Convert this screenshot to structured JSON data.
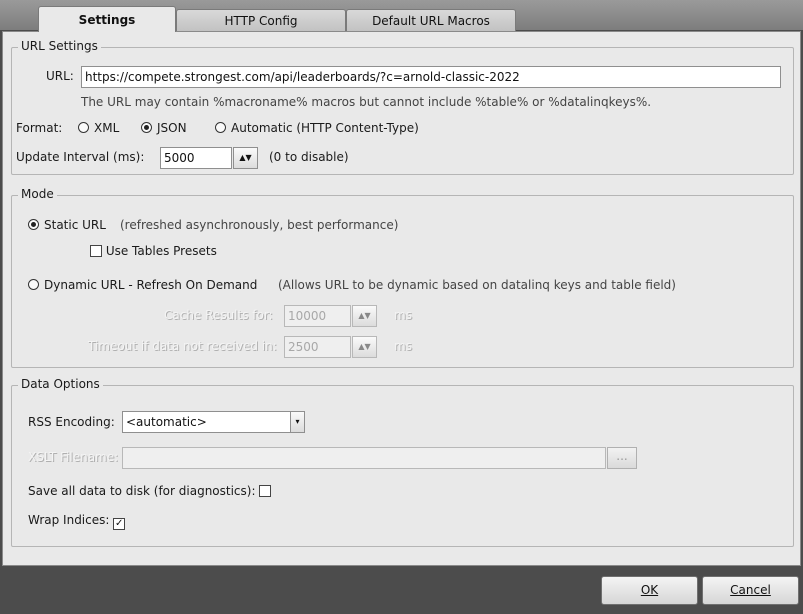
{
  "tabs": [
    {
      "label": "Settings",
      "active": true
    },
    {
      "label": "HTTP Config",
      "active": false
    },
    {
      "label": "Default URL Macros",
      "active": false
    }
  ],
  "url_settings": {
    "legend": "URL Settings",
    "url_label": "URL:",
    "url_value": "https://compete.strongest.com/api/leaderboards/?c=arnold-classic-2022",
    "url_hint": "The URL may contain %macroname% macros but cannot include %table% or %datalinqkeys%.",
    "format_label": "Format:",
    "format_options": [
      "XML",
      "JSON",
      "Automatic (HTTP Content-Type)"
    ],
    "format_selected": "JSON",
    "interval_label": "Update Interval (ms):",
    "interval_value": "5000",
    "interval_hint": "(0 to disable)"
  },
  "mode": {
    "legend": "Mode",
    "static_label": "Static URL",
    "static_hint": "(refreshed asynchronously, best performance)",
    "use_presets_label": "Use Tables Presets",
    "use_presets_checked": false,
    "dynamic_label": "Dynamic URL - Refresh On Demand",
    "dynamic_hint": "(Allows URL to be dynamic based on datalinq keys and table field)",
    "selected": "Static URL",
    "cache_label": "Cache Results for:",
    "cache_value": "10000",
    "cache_unit": "ms",
    "timeout_label": "Timeout if data not received in:",
    "timeout_value": "2500",
    "timeout_unit": "ms"
  },
  "data_options": {
    "legend": "Data Options",
    "rss_label": "RSS Encoding:",
    "rss_value": "<automatic>",
    "xslt_label": "XSLT Filename:",
    "xslt_value": "",
    "browse_label": "...",
    "save_label": "Save all data to disk (for diagnostics):",
    "save_checked": false,
    "wrap_label": "Wrap Indices:",
    "wrap_checked": true
  },
  "buttons": {
    "ok": "OK",
    "cancel": "Cancel"
  },
  "icons": {
    "spin": "▲▼",
    "dropdown": "▾",
    "check": "✓"
  }
}
